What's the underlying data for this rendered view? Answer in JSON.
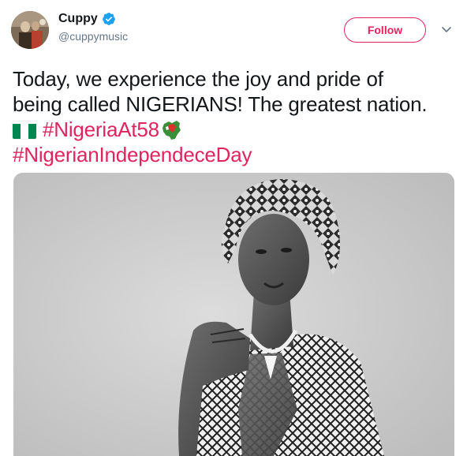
{
  "user": {
    "display_name": "Cuppy",
    "handle": "@cuppymusic",
    "verified": true,
    "avatar_icon": "avatar"
  },
  "actions": {
    "follow_label": "Follow",
    "menu_icon": "chevron-down-icon"
  },
  "tweet": {
    "line1": "Today, we experience the joy and pride of",
    "line2": "being called NIGERIANS! The greatest nation.",
    "hashtag1": "#NigeriaAt58",
    "hashtag2": "#NigerianIndependeceDay",
    "emoji_flag": "nigeria-flag-icon",
    "emoji_map": "nigeria-map-icon"
  },
  "media": {
    "type": "photo",
    "style": "black-and-white portrait"
  },
  "colors": {
    "accent": "#e0245e",
    "text": "#14171a",
    "secondary_text": "#657786",
    "verified": "#1da1f2",
    "flag_green": "#008751"
  }
}
